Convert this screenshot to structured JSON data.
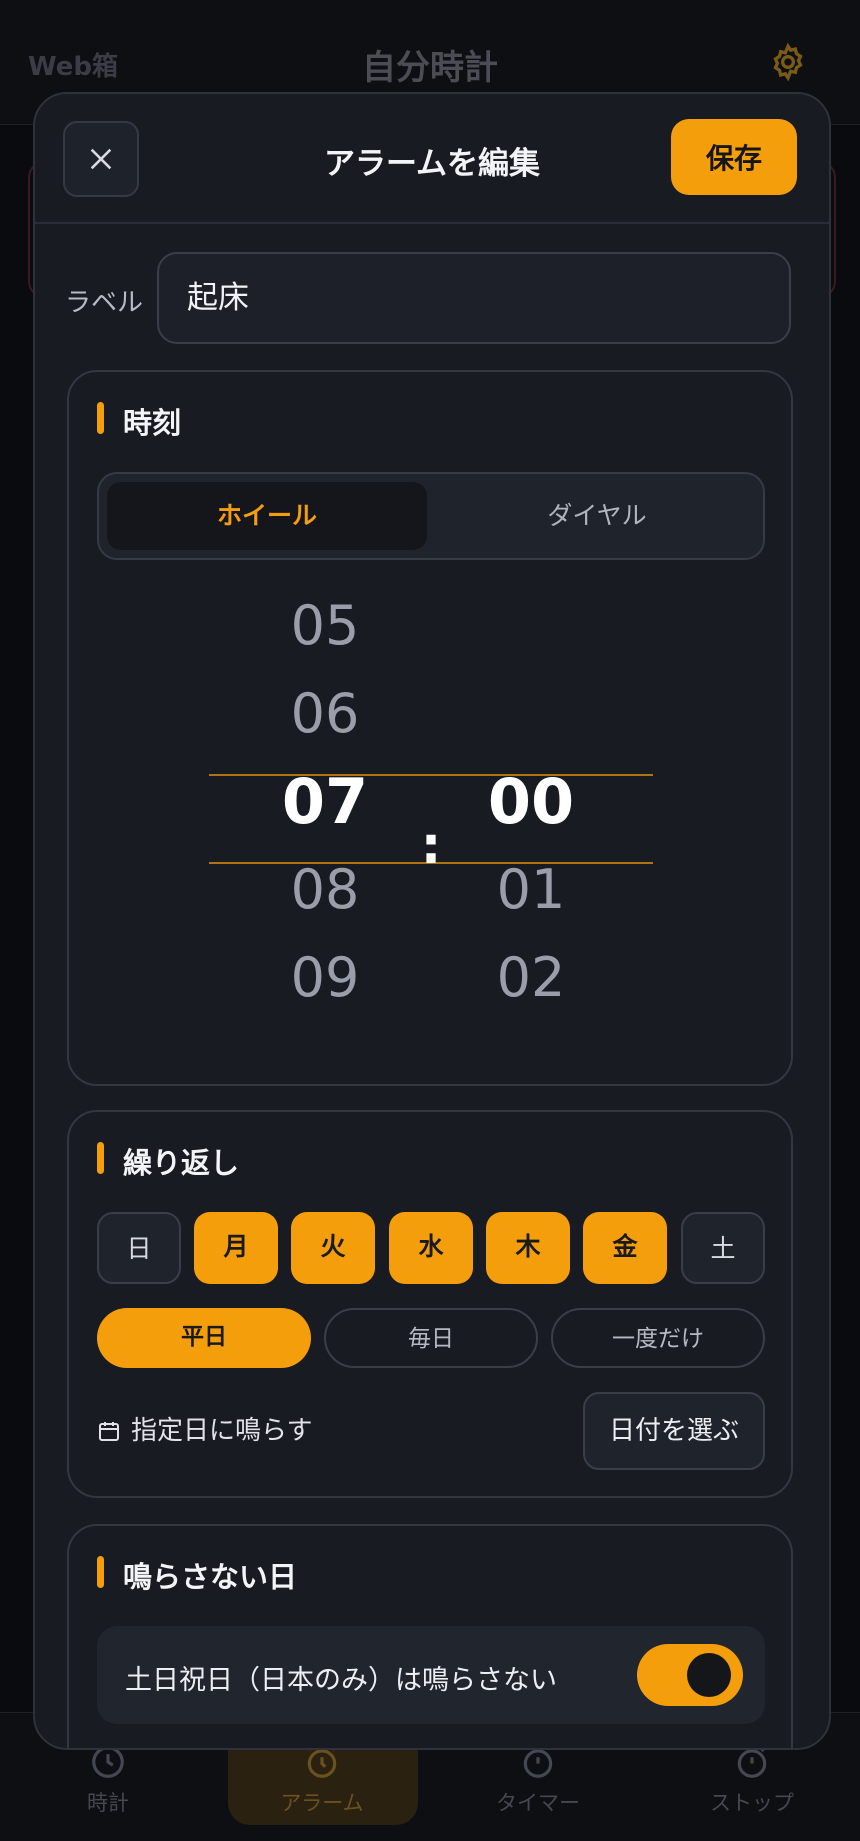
{
  "app": {
    "brand": "Web箱",
    "title": "自分時計"
  },
  "nav": {
    "items": [
      {
        "label": "時計",
        "icon": "clock-icon"
      },
      {
        "label": "アラーム",
        "icon": "alarm-icon",
        "active": true
      },
      {
        "label": "タイマー",
        "icon": "timer-icon"
      },
      {
        "label": "ストップ",
        "icon": "stopwatch-icon"
      }
    ]
  },
  "modal": {
    "title": "アラームを編集",
    "save_label": "保存",
    "label_caption": "ラベル",
    "label_value": "起床"
  },
  "time": {
    "section_title": "時刻",
    "mode_wheel": "ホイール",
    "mode_dial": "ダイヤル",
    "hours": [
      "05",
      "06",
      "07",
      "08",
      "09"
    ],
    "minutes": [
      "00",
      "01",
      "02"
    ],
    "selected_hour": "07",
    "selected_minute": "00",
    "separator": ":"
  },
  "repeat": {
    "section_title": "繰り返し",
    "days": [
      {
        "label": "日",
        "on": false
      },
      {
        "label": "月",
        "on": true
      },
      {
        "label": "火",
        "on": true
      },
      {
        "label": "水",
        "on": true
      },
      {
        "label": "木",
        "on": true
      },
      {
        "label": "金",
        "on": true
      },
      {
        "label": "土",
        "on": false
      }
    ],
    "presets": [
      {
        "label": "平日",
        "on": true
      },
      {
        "label": "毎日",
        "on": false
      },
      {
        "label": "一度だけ",
        "on": false
      }
    ],
    "date_label": "指定日に鳴らす",
    "date_button": "日付を選ぶ"
  },
  "skip": {
    "section_title": "鳴らさない日",
    "holiday_label": "土日祝日（日本のみ）は鳴らさない",
    "holiday_enabled": true
  },
  "colors": {
    "accent": "#f59e0b",
    "background": "#0a0b0e",
    "modal": "#181b22"
  }
}
